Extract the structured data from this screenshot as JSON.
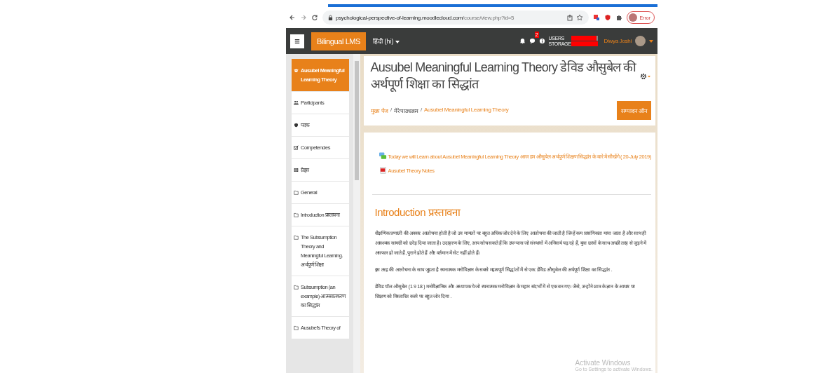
{
  "browser": {
    "url_host": "psychological-perspective-of-learning.moodlecloud.com",
    "url_path": "/course/view.php?id=5",
    "profile_status": "Error"
  },
  "navbar": {
    "brand": "Bilingual LMS",
    "language": "हिंदी (hi)",
    "badge_count": "2",
    "quota": [
      {
        "label": "USERS",
        "level": 0.97
      },
      {
        "label": "STORAGE",
        "level": 1
      }
    ],
    "user_name": "Diwya Joshi"
  },
  "sidebar": {
    "items": [
      {
        "label": "Ausubel Meaningful Learning Theory",
        "kind": "course",
        "selected": true
      },
      {
        "label": "Participants",
        "kind": "users",
        "selected": false
      },
      {
        "label": "पदक",
        "kind": "badge",
        "selected": false
      },
      {
        "label": "Competencies",
        "kind": "check",
        "selected": false
      },
      {
        "label": "ग्रेड्स",
        "kind": "table",
        "selected": false
      },
      {
        "label": "General",
        "kind": "folder",
        "selected": false
      },
      {
        "label": "Introduction प्रस्तावना",
        "kind": "folder",
        "selected": false
      },
      {
        "label": "The Subsumption Theory and Meaningful Learning. अर्थपूर्ण शिक्षा",
        "kind": "folder",
        "selected": false
      },
      {
        "label": "Subsumption (an example) आत्मसातकरण का सिद्धांत",
        "kind": "folder",
        "selected": false
      },
      {
        "label": "Ausubel's Theory of",
        "kind": "folder",
        "selected": false
      }
    ]
  },
  "header": {
    "title": "Ausubel Meaningful Learning Theory डेविड औसुबेल की अर्थपूर्ण शिक्षा का सिद्धांत",
    "breadcrumbs": [
      {
        "label": "मुख्य पेज",
        "link": true
      },
      {
        "label": "मेरे पाठ्यक्रम",
        "link": false
      },
      {
        "label": "Ausubel Meaningful Learning Theory",
        "link": true
      }
    ],
    "separator": "/",
    "edit_button": "सम्पादन ऑन"
  },
  "activities": [
    {
      "kind": "chat",
      "label": "Today we will Learn about Ausubel Meaningful Learning Theory आज हम औसुबेल अर्थपूर्ण शिक्षण सिद्धांत के बारे में सीखेंगे ( 20-July 2019)"
    },
    {
      "kind": "pdf",
      "label": "Ausubel Theory Notes"
    }
  ],
  "section": {
    "heading_en": "Introduction",
    "heading_hi": "प्रस्तावना",
    "paragraphs": [
      "शैक्षणिक प्रणाली की अक्सर आलोचना होती है जो उन मामलों पर बहुत अधिक जोर देने के लिए आलोचना की जाती है जिन्हें कम प्रासंगिकता माना जाता है और साथ ही आवश्यक सामग्री को छोड़ दिया जाता है। उदाहरण के लिए, आप सोच सकते हैं कि उपन्यास जो संस्थानों में अनिवार्य पढ़ रहे हैं, युवा छात्रों के साथ अच्छी तरह से जुड़ने में असफल हो जाते हैं, पुराने होते हैं और वर्तमान में सेट नहीं होते हैं।",
      "इस तरह की आलोचना के साथ जुड़ता है रचनात्मक मनोविज्ञान के सबसे महत्वपूर्ण सिद्धांतों में से एक: डेविड औसुबेल की अर्थपूर्ण शिक्षा का सिद्धांत .",
      "डेविड पॉल औसुबेल (1 9 18 ) मनोवैज्ञानिक और अध्यापक थे जो रचनात्मक मनोविज्ञान के महान संदर्भों में से एक बन गए। जैसे, उन्होंने छात्र के ज्ञान के आधार पर शिक्षण को विस्तारित करने पर बहुत जोर दिया ."
    ]
  },
  "os_notice": {
    "title": "Activate Windows",
    "subtitle": "Go to Settings to activate Windows."
  }
}
